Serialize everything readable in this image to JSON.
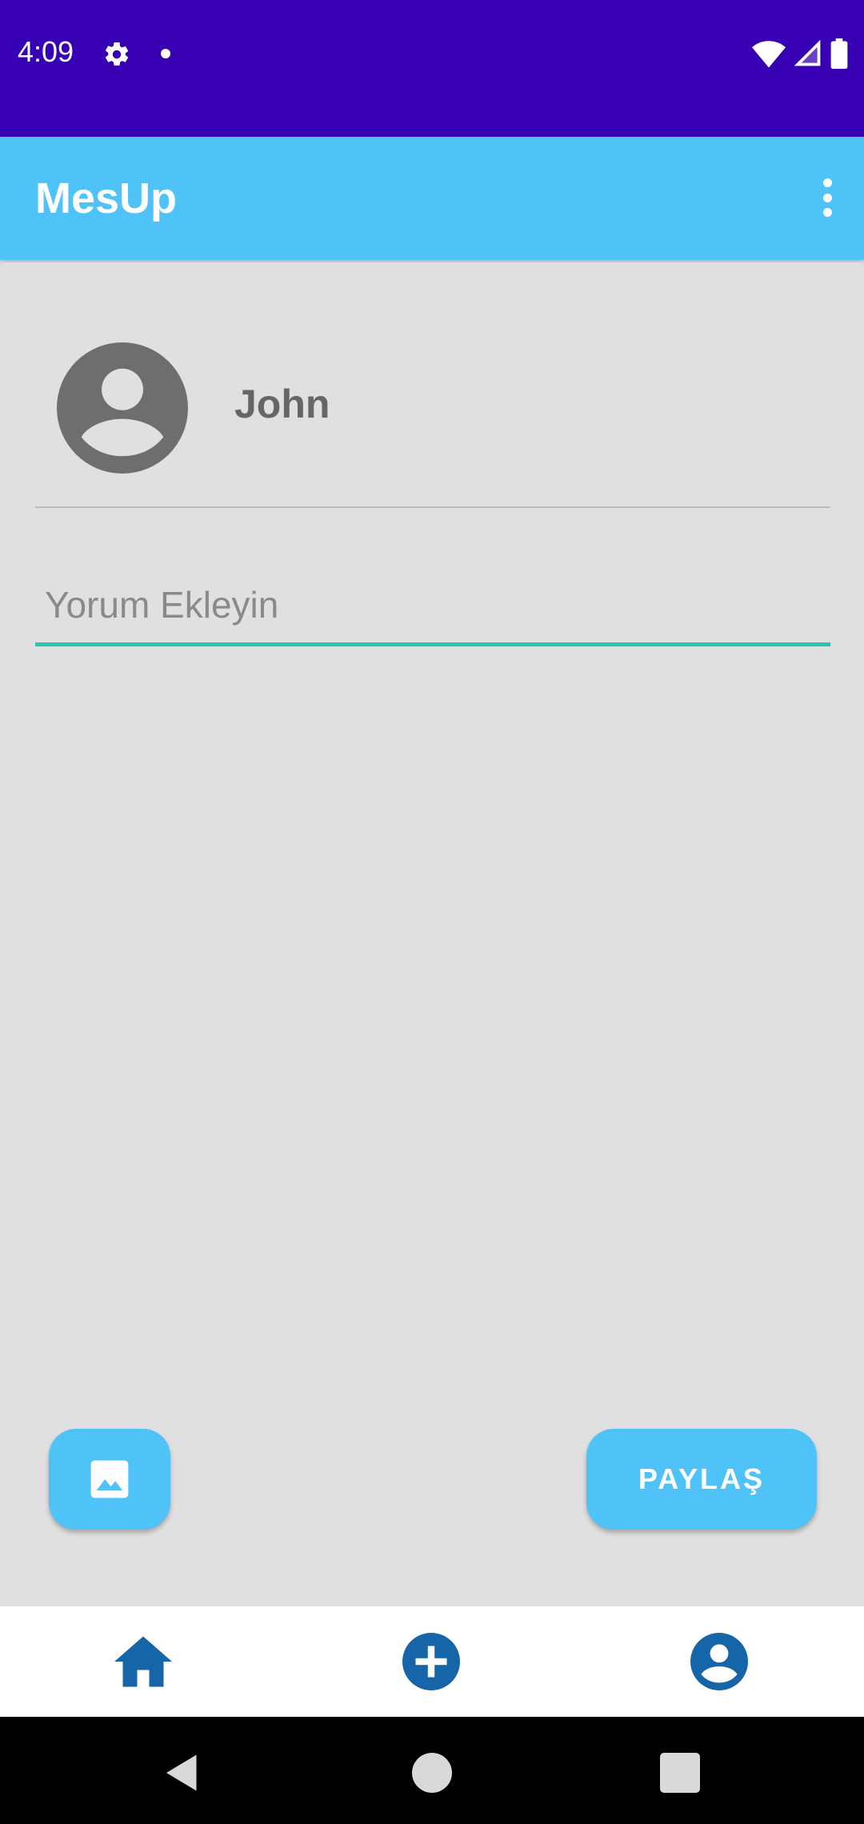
{
  "status_bar": {
    "time": "4:09",
    "icons": [
      "gear-icon",
      "dot-icon",
      "wifi-icon",
      "signal-icon",
      "battery-icon"
    ]
  },
  "app_bar": {
    "title": "MesUp",
    "menu_icon": "overflow-menu-icon"
  },
  "post": {
    "avatar_icon": "account-circle-icon",
    "username": "John",
    "comment_placeholder": "Yorum Ekleyin",
    "comment_value": ""
  },
  "actions": {
    "image_icon": "image-icon",
    "share_label": "PAYLAŞ"
  },
  "bottom_nav": {
    "items": [
      {
        "icon": "home-icon"
      },
      {
        "icon": "add-circle-icon"
      },
      {
        "icon": "profile-icon"
      }
    ]
  },
  "system_nav": {
    "buttons": [
      "back-icon",
      "home-circle-icon",
      "recents-icon"
    ]
  },
  "colors": {
    "status_bar": "#3700b3",
    "app_bar": "#4fc3f7",
    "input_underline": "#26c6b4",
    "nav_icon": "#1565a8",
    "background": "#e0e0e0"
  }
}
